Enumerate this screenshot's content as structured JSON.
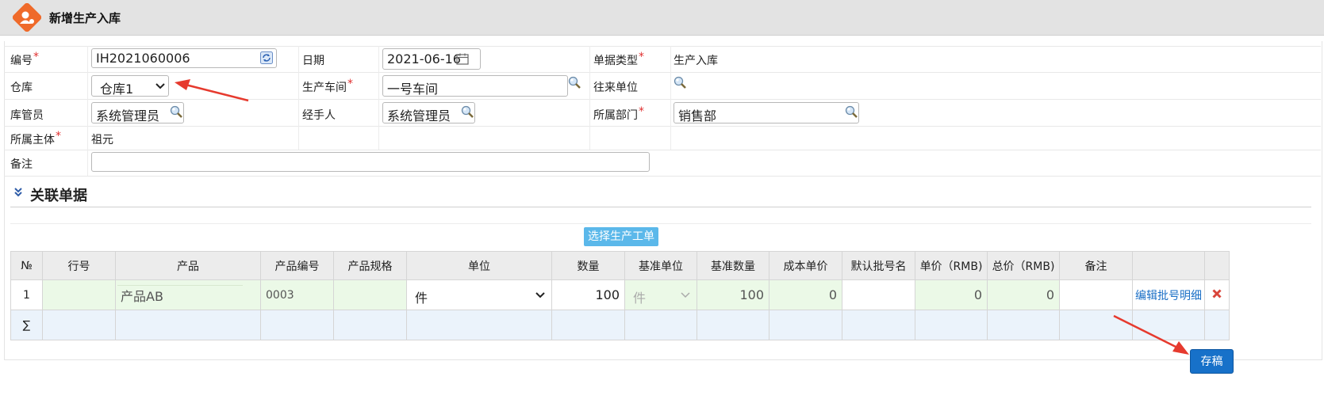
{
  "window": {
    "title": "新增生产入库",
    "logo_icon": "person-badge-icon"
  },
  "form": {
    "code": {
      "label": "编号",
      "value": "IH2021060006",
      "required": true
    },
    "date": {
      "label": "日期",
      "value": "2021-06-16"
    },
    "doc_type": {
      "label": "单据类型",
      "value": "生产入库",
      "required": true
    },
    "warehouse": {
      "label": "仓库",
      "value": "仓库1"
    },
    "workshop": {
      "label": "生产车间",
      "value": "一号车间",
      "required": true
    },
    "partner": {
      "label": "往来单位",
      "value": ""
    },
    "keeper": {
      "label": "库管员",
      "value": "系统管理员"
    },
    "handler": {
      "label": "经手人",
      "value": "系统管理员"
    },
    "department": {
      "label": "所属部门",
      "value": "销售部",
      "required": true
    },
    "entity": {
      "label": "所属主体",
      "value": "祖元",
      "required": true
    },
    "remark": {
      "label": "备注",
      "value": ""
    }
  },
  "section": {
    "title": "关联单据"
  },
  "select_order_button": "选择生产工单",
  "table": {
    "headers": [
      "№",
      "行号",
      "产品",
      "产品编号",
      "产品规格",
      "单位",
      "数量",
      "基准单位",
      "基准数量",
      "成本单价",
      "默认批号名",
      "单价（RMB)",
      "总价（RMB)",
      "备注",
      "",
      ""
    ],
    "row": {
      "no": "1",
      "line": "",
      "product": "产品AB",
      "product_code": "0003",
      "spec": "",
      "unit": "件",
      "qty": "100",
      "base_unit": "件",
      "base_qty": "100",
      "cost_price": "0",
      "batch": "",
      "unit_price": "0",
      "total": "0",
      "remark": "",
      "edit_link": "编辑批号明细"
    },
    "sum_symbol": "∑"
  },
  "save_button": "存稿",
  "colors": {
    "accent": "#1771c9",
    "required": "#e03030",
    "green_cell": "#ebf9e7",
    "arrow": "#e63a2e"
  }
}
